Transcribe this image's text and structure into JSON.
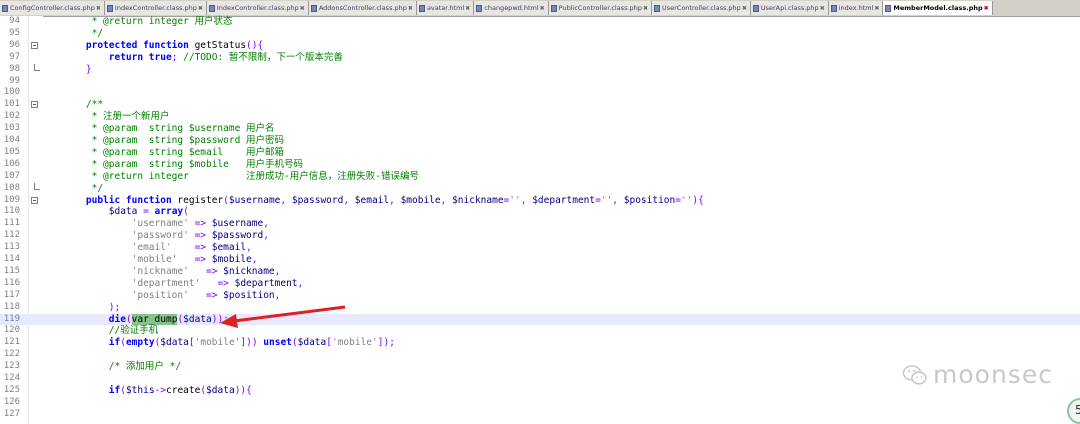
{
  "tabs": [
    {
      "label": "ConfigController.class.php",
      "active": false
    },
    {
      "label": "IndexController.class.php",
      "active": false
    },
    {
      "label": "IndexController.class.php",
      "active": false
    },
    {
      "label": "AddonsController.class.php",
      "active": false
    },
    {
      "label": "avatar.html",
      "active": false
    },
    {
      "label": "changepwd.html",
      "active": false
    },
    {
      "label": "PublicController.class.php",
      "active": false
    },
    {
      "label": "UserController.class.php",
      "active": false
    },
    {
      "label": "UserApi.class.php",
      "active": false
    },
    {
      "label": "index.html",
      "active": false
    },
    {
      "label": "MemberModel.class.php",
      "active": true
    }
  ],
  "lines": [
    {
      "n": "94",
      "segs": [
        {
          "t": "     * @return integer 用户状态",
          "c": "cm"
        }
      ]
    },
    {
      "n": "95",
      "segs": [
        {
          "t": "     */",
          "c": "cm"
        }
      ]
    },
    {
      "n": "96",
      "fold": "open",
      "segs": [
        {
          "t": "    ",
          "c": ""
        },
        {
          "t": "protected function",
          "c": "kw"
        },
        {
          "t": " getStatus",
          "c": ""
        },
        {
          "t": "(){",
          "c": "op"
        }
      ]
    },
    {
      "n": "97",
      "segs": [
        {
          "t": "        ",
          "c": ""
        },
        {
          "t": "return true",
          "c": "kw"
        },
        {
          "t": "; ",
          "c": "op"
        },
        {
          "t": "//TODO: 暂不限制，下一个版本完善",
          "c": "cm"
        }
      ]
    },
    {
      "n": "98",
      "fold": "end",
      "segs": [
        {
          "t": "    }",
          "c": "op"
        }
      ]
    },
    {
      "n": "99",
      "segs": []
    },
    {
      "n": "100",
      "segs": []
    },
    {
      "n": "101",
      "fold": "open",
      "segs": [
        {
          "t": "    /**",
          "c": "cm"
        }
      ]
    },
    {
      "n": "102",
      "segs": [
        {
          "t": "     * 注册一个新用户",
          "c": "cm"
        }
      ]
    },
    {
      "n": "103",
      "segs": [
        {
          "t": "     * @param  string $username 用户名",
          "c": "cm"
        }
      ]
    },
    {
      "n": "104",
      "segs": [
        {
          "t": "     * @param  string $password 用户密码",
          "c": "cm"
        }
      ]
    },
    {
      "n": "105",
      "segs": [
        {
          "t": "     * @param  string $email    用户邮箱",
          "c": "cm"
        }
      ]
    },
    {
      "n": "106",
      "segs": [
        {
          "t": "     * @param  string $mobile   用户手机号码",
          "c": "cm"
        }
      ]
    },
    {
      "n": "107",
      "segs": [
        {
          "t": "     * @return integer          注册成功-用户信息，注册失败-错误编号",
          "c": "cm"
        }
      ]
    },
    {
      "n": "108",
      "fold": "end",
      "segs": [
        {
          "t": "     */",
          "c": "cm"
        }
      ]
    },
    {
      "n": "109",
      "fold": "open",
      "segs": [
        {
          "t": "    ",
          "c": ""
        },
        {
          "t": "public function",
          "c": "kw"
        },
        {
          "t": " register",
          "c": ""
        },
        {
          "t": "(",
          "c": "op"
        },
        {
          "t": "$username",
          "c": "var"
        },
        {
          "t": ", ",
          "c": "op"
        },
        {
          "t": "$password",
          "c": "var"
        },
        {
          "t": ", ",
          "c": "op"
        },
        {
          "t": "$email",
          "c": "var"
        },
        {
          "t": ", ",
          "c": "op"
        },
        {
          "t": "$mobile",
          "c": "var"
        },
        {
          "t": ", ",
          "c": "op"
        },
        {
          "t": "$nickname",
          "c": "var"
        },
        {
          "t": "=",
          "c": "op"
        },
        {
          "t": "''",
          "c": "str"
        },
        {
          "t": ", ",
          "c": "op"
        },
        {
          "t": "$department",
          "c": "var"
        },
        {
          "t": "=",
          "c": "op"
        },
        {
          "t": "''",
          "c": "str"
        },
        {
          "t": ", ",
          "c": "op"
        },
        {
          "t": "$position",
          "c": "var"
        },
        {
          "t": "=",
          "c": "op"
        },
        {
          "t": "''",
          "c": "str"
        },
        {
          "t": "){",
          "c": "op"
        }
      ]
    },
    {
      "n": "110",
      "segs": [
        {
          "t": "        ",
          "c": ""
        },
        {
          "t": "$data",
          "c": "var"
        },
        {
          "t": " = ",
          "c": "op"
        },
        {
          "t": "array",
          "c": "kw"
        },
        {
          "t": "(",
          "c": "op"
        }
      ]
    },
    {
      "n": "111",
      "segs": [
        {
          "t": "            ",
          "c": ""
        },
        {
          "t": "'username'",
          "c": "str"
        },
        {
          "t": " => ",
          "c": "op"
        },
        {
          "t": "$username",
          "c": "var"
        },
        {
          "t": ",",
          "c": "op"
        }
      ]
    },
    {
      "n": "112",
      "segs": [
        {
          "t": "            ",
          "c": ""
        },
        {
          "t": "'password'",
          "c": "str"
        },
        {
          "t": " => ",
          "c": "op"
        },
        {
          "t": "$password",
          "c": "var"
        },
        {
          "t": ",",
          "c": "op"
        }
      ]
    },
    {
      "n": "113",
      "segs": [
        {
          "t": "            ",
          "c": ""
        },
        {
          "t": "'email'",
          "c": "str"
        },
        {
          "t": "    => ",
          "c": "op"
        },
        {
          "t": "$email",
          "c": "var"
        },
        {
          "t": ",",
          "c": "op"
        }
      ]
    },
    {
      "n": "114",
      "segs": [
        {
          "t": "            ",
          "c": ""
        },
        {
          "t": "'mobile'",
          "c": "str"
        },
        {
          "t": "   => ",
          "c": "op"
        },
        {
          "t": "$mobile",
          "c": "var"
        },
        {
          "t": ",",
          "c": "op"
        }
      ]
    },
    {
      "n": "115",
      "segs": [
        {
          "t": "            ",
          "c": ""
        },
        {
          "t": "'nickname'",
          "c": "str"
        },
        {
          "t": "   => ",
          "c": "op"
        },
        {
          "t": "$nickname",
          "c": "var"
        },
        {
          "t": ",",
          "c": "op"
        }
      ]
    },
    {
      "n": "116",
      "segs": [
        {
          "t": "            ",
          "c": ""
        },
        {
          "t": "'department'",
          "c": "str"
        },
        {
          "t": "   => ",
          "c": "op"
        },
        {
          "t": "$department",
          "c": "var"
        },
        {
          "t": ",",
          "c": "op"
        }
      ]
    },
    {
      "n": "117",
      "segs": [
        {
          "t": "            ",
          "c": ""
        },
        {
          "t": "'position'",
          "c": "str"
        },
        {
          "t": "   => ",
          "c": "op"
        },
        {
          "t": "$position",
          "c": "var"
        },
        {
          "t": ",",
          "c": "op"
        }
      ]
    },
    {
      "n": "118",
      "segs": [
        {
          "t": "        );",
          "c": "op"
        }
      ]
    },
    {
      "n": "119",
      "hl": true,
      "segs": [
        {
          "t": "        ",
          "c": ""
        },
        {
          "t": "die",
          "c": "kw"
        },
        {
          "t": "(",
          "c": "op"
        },
        {
          "t": "var_dump",
          "c": "sel"
        },
        {
          "t": "(",
          "c": "op"
        },
        {
          "t": "$data",
          "c": "var"
        },
        {
          "t": "));",
          "c": "op"
        }
      ]
    },
    {
      "n": "120",
      "segs": [
        {
          "t": "        //验证手机",
          "c": "cm"
        }
      ]
    },
    {
      "n": "121",
      "segs": [
        {
          "t": "        ",
          "c": ""
        },
        {
          "t": "if",
          "c": "kw"
        },
        {
          "t": "(",
          "c": "op"
        },
        {
          "t": "empty",
          "c": "kw"
        },
        {
          "t": "(",
          "c": "op"
        },
        {
          "t": "$data",
          "c": "var"
        },
        {
          "t": "[",
          "c": "op"
        },
        {
          "t": "'mobile'",
          "c": "str"
        },
        {
          "t": "])) ",
          "c": "op"
        },
        {
          "t": "unset",
          "c": "kw"
        },
        {
          "t": "(",
          "c": "op"
        },
        {
          "t": "$data",
          "c": "var"
        },
        {
          "t": "[",
          "c": "op"
        },
        {
          "t": "'mobile'",
          "c": "str"
        },
        {
          "t": "]);",
          "c": "op"
        }
      ]
    },
    {
      "n": "122",
      "segs": []
    },
    {
      "n": "123",
      "segs": [
        {
          "t": "        /* 添加用户 */",
          "c": "cm"
        }
      ]
    },
    {
      "n": "124",
      "segs": []
    },
    {
      "n": "125",
      "segs": [
        {
          "t": "        ",
          "c": ""
        },
        {
          "t": "if",
          "c": "kw"
        },
        {
          "t": "(",
          "c": "op"
        },
        {
          "t": "$this",
          "c": "var"
        },
        {
          "t": "->",
          "c": "op"
        },
        {
          "t": "create",
          "c": ""
        },
        {
          "t": "(",
          "c": "op"
        },
        {
          "t": "$data",
          "c": "var"
        },
        {
          "t": ")){",
          "c": "op"
        }
      ]
    },
    {
      "n": "126",
      "segs": []
    },
    {
      "n": "127",
      "segs": []
    }
  ],
  "watermark": {
    "text": "moonsec",
    "icon": "wechat-icon"
  },
  "badge": {
    "text": "5"
  },
  "colors": {
    "arrow": "#e02020",
    "selection": "#86c38a",
    "current_line": "#e8e8ff"
  }
}
